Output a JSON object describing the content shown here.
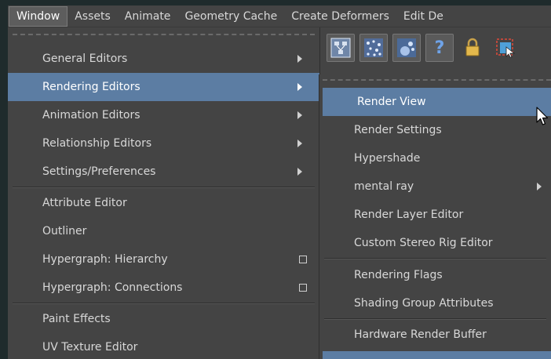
{
  "menubar": {
    "items": [
      "Window",
      "Assets",
      "Animate",
      "Geometry Cache",
      "Create Deformers",
      "Edit De"
    ]
  },
  "window_menu": {
    "items": [
      {
        "label": "General Editors"
      },
      {
        "label": "Rendering Editors"
      },
      {
        "label": "Animation Editors"
      },
      {
        "label": "Relationship Editors"
      },
      {
        "label": "Settings/Preferences"
      },
      {
        "label": "Attribute Editor"
      },
      {
        "label": "Outliner"
      },
      {
        "label": "Hypergraph: Hierarchy"
      },
      {
        "label": "Hypergraph: Connections"
      },
      {
        "label": "Paint Effects"
      },
      {
        "label": "UV Texture Editor"
      }
    ],
    "highlighted": "Rendering Editors"
  },
  "toolbar": {
    "icons": [
      "hypergraph-icon",
      "particles-icon",
      "paint-effects-icon",
      "help-icon",
      "lock-icon",
      "select-object-icon"
    ],
    "help_glyph": "?"
  },
  "rendering_submenu": {
    "items": [
      {
        "label": "Render View"
      },
      {
        "label": "Render Settings"
      },
      {
        "label": "Hypershade"
      },
      {
        "label": "mental ray"
      },
      {
        "label": "Render Layer Editor"
      },
      {
        "label": "Custom Stereo Rig Editor"
      },
      {
        "label": "Rendering Flags"
      },
      {
        "label": "Shading Group Attributes"
      },
      {
        "label": "Hardware Render Buffer"
      }
    ],
    "highlighted": "Render View"
  },
  "colors": {
    "menu_bg": "#444444",
    "highlight": "#5c7da3",
    "text": "#d8d8d8",
    "background": "#1f2b2c"
  }
}
